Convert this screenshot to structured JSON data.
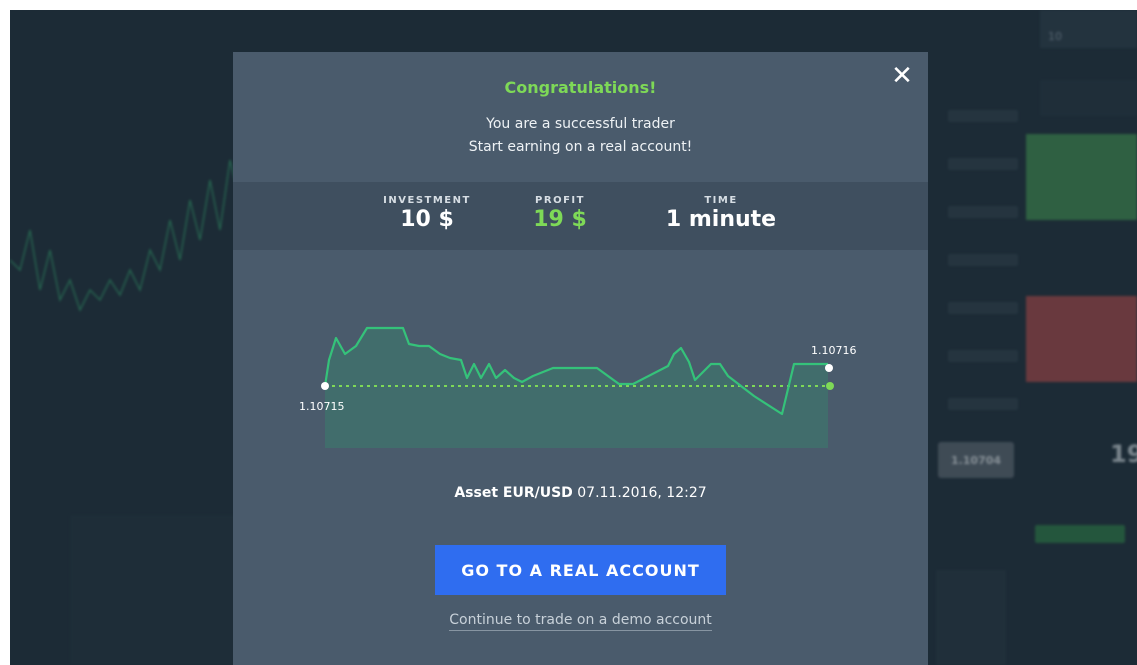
{
  "modal": {
    "title": "Congratulations!",
    "line1": "You are a successful trader",
    "line2": "Start earning on a real account!",
    "close_icon": "close-icon",
    "stats": {
      "investment_label": "INVESTMENT",
      "investment_value": "10 $",
      "profit_label": "PROFIT",
      "profit_value": "19 $",
      "time_label": "TIME",
      "time_value": "1 minute"
    },
    "chart": {
      "start_price": "1.10715",
      "end_price": "1.10716",
      "line_color": "#35c27a",
      "dotted_color": "#7ed957"
    },
    "asset_prefix": "Asset EUR/USD",
    "asset_datetime": "07.11.2016, 12:27",
    "cta_label": "GO TO A REAL ACCOUNT",
    "demo_link": "Continue to trade on a demo account"
  },
  "background": {
    "price_tag": "1.10704",
    "amount_input": "10",
    "side_number": "19"
  },
  "colors": {
    "accent_green": "#7ed957",
    "cta_blue": "#2f6df0",
    "modal_bg": "#4a5b6c"
  }
}
